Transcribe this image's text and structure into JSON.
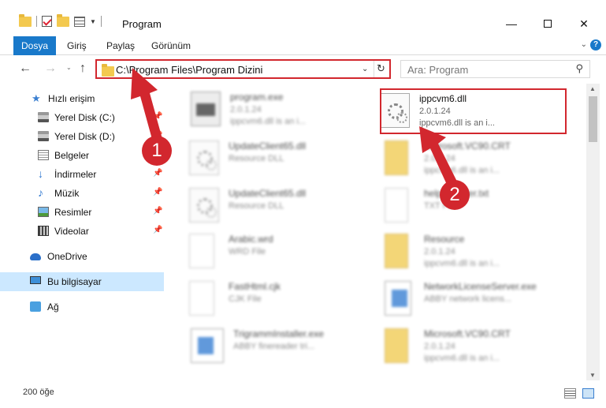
{
  "window": {
    "title": "Program",
    "min_glyph": "—",
    "close_glyph": "✕"
  },
  "ribbon": {
    "tabs": [
      "Dosya",
      "Giriş",
      "Paylaş",
      "Görünüm"
    ],
    "expand_glyph": "⌄",
    "help_glyph": "?"
  },
  "nav": {
    "back_glyph": "←",
    "forward_glyph": "→",
    "recent_glyph": "⌄",
    "up_glyph": "↑",
    "address": "C:\\Program Files\\Program Dizini",
    "address_dd_glyph": "⌄",
    "refresh_glyph": "↻",
    "search_placeholder": "Ara: Program",
    "search_glyph": "⚲"
  },
  "sidebar": {
    "items": [
      {
        "label": "Hızlı erişim",
        "icon": "star-icon"
      },
      {
        "label": "Yerel Disk (C:)",
        "icon": "disk-icon",
        "pinned": true
      },
      {
        "label": "Yerel Disk (D:)",
        "icon": "disk-icon",
        "pinned": true
      },
      {
        "label": "Belgeler",
        "icon": "documents-icon",
        "pinned": true
      },
      {
        "label": "İndirmeler",
        "icon": "download-icon",
        "pinned": true
      },
      {
        "label": "Müzik",
        "icon": "music-icon",
        "pinned": true
      },
      {
        "label": "Resimler",
        "icon": "pictures-icon",
        "pinned": true
      },
      {
        "label": "Videolar",
        "icon": "video-icon",
        "pinned": true
      },
      {
        "label": "OneDrive",
        "icon": "cloud-icon"
      },
      {
        "label": "Bu bilgisayar",
        "icon": "computer-icon",
        "selected": true
      },
      {
        "label": "Ağ",
        "icon": "network-icon"
      }
    ],
    "pin_glyph": "📌",
    "star_glyph": "★",
    "download_glyph": "↓",
    "music_glyph": "♪"
  },
  "files": [
    {
      "name": "program.exe",
      "line2": "2.0.1.24",
      "line3": "ippcvm6.dll is an i...",
      "kind": "exe2",
      "blurred": true
    },
    {
      "name": "ippcvm6.dll",
      "line2": "2.0.1.24",
      "line3": "ippcvm6.dll is an i...",
      "kind": "dll",
      "blurred": false
    },
    {
      "name": "UpdateClient65.dll",
      "line2": "Resource DLL",
      "line3": "",
      "kind": "dll",
      "blurred": true
    },
    {
      "name": "Microsoft.VC90.CRT",
      "line2": "2.0.1.24",
      "line3": "ippcvm6.dll is an i...",
      "kind": "zip",
      "blurred": true
    },
    {
      "name": "UpdateClient65.dll",
      "line2": "Resource DLL",
      "line3": "",
      "kind": "dll",
      "blurred": true
    },
    {
      "name": "help_header.txt",
      "line2": "TXT File",
      "line3": "",
      "kind": "doc",
      "blurred": true
    },
    {
      "name": "Arabic.wrd",
      "line2": "WRD File",
      "line3": "",
      "kind": "doc",
      "blurred": true
    },
    {
      "name": "Resource",
      "line2": "2.0.1.24",
      "line3": "ippcvm6.dll is an i...",
      "kind": "zip",
      "blurred": true
    },
    {
      "name": "FastHtml.cjk",
      "line2": "CJK File",
      "line3": "",
      "kind": "doc",
      "blurred": true
    },
    {
      "name": "NetworkLicenseServer.exe",
      "line2": "ABBY network licens...",
      "line3": "",
      "kind": "exe",
      "blurred": true
    },
    {
      "name": "TrigrammInstaller.exe",
      "line2": "ABBY finereader tri...",
      "line3": "",
      "kind": "exe",
      "blurred": true
    },
    {
      "name": "Microsoft.VC90.CRT",
      "line2": "2.0.1.24",
      "line3": "ippcvm6.dll is an i...",
      "kind": "zip",
      "blurred": true
    }
  ],
  "scrollbar": {
    "up_glyph": "▲",
    "down_glyph": "▼"
  },
  "status": {
    "item_count": "200 öğe"
  },
  "annotations": {
    "marker1": "1",
    "marker2": "2"
  },
  "colors": {
    "accent": "#1979ca",
    "highlight": "#d2272e",
    "selected": "#cce8ff"
  }
}
